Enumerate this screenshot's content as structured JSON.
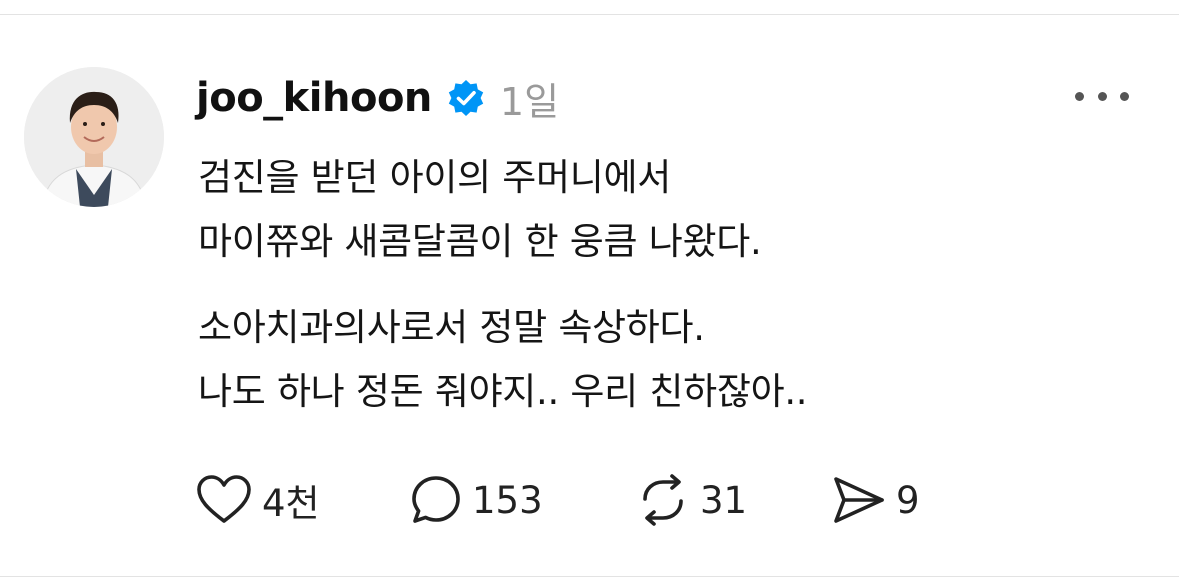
{
  "post": {
    "author": {
      "username": "joo_kihoon",
      "verified": true,
      "avatar_icon": "profile-photo"
    },
    "timestamp": "1일",
    "menu_icon": "more-dots-icon",
    "body": {
      "paragraph_1": [
        "검진을 받던 아이의 주머니에서",
        "마이쮸와 새콤달콤이 한 웅큼 나왔다."
      ],
      "paragraph_2": [
        "소아치과의사로서 정말 속상하다.",
        "나도 하나 정돈 줘야지.. 우리 친하잖아.."
      ]
    },
    "actions": {
      "like": {
        "icon": "heart-icon",
        "count": "4천"
      },
      "comment": {
        "icon": "comment-icon",
        "count": "153"
      },
      "repost": {
        "icon": "repost-icon",
        "count": "31"
      },
      "share": {
        "icon": "send-icon",
        "count": "9"
      }
    }
  },
  "colors": {
    "background": "#ffffff",
    "text": "#111111",
    "muted": "#9a9a9a",
    "verified_badge": "#0095f6",
    "divider": "#e3e3e3"
  }
}
